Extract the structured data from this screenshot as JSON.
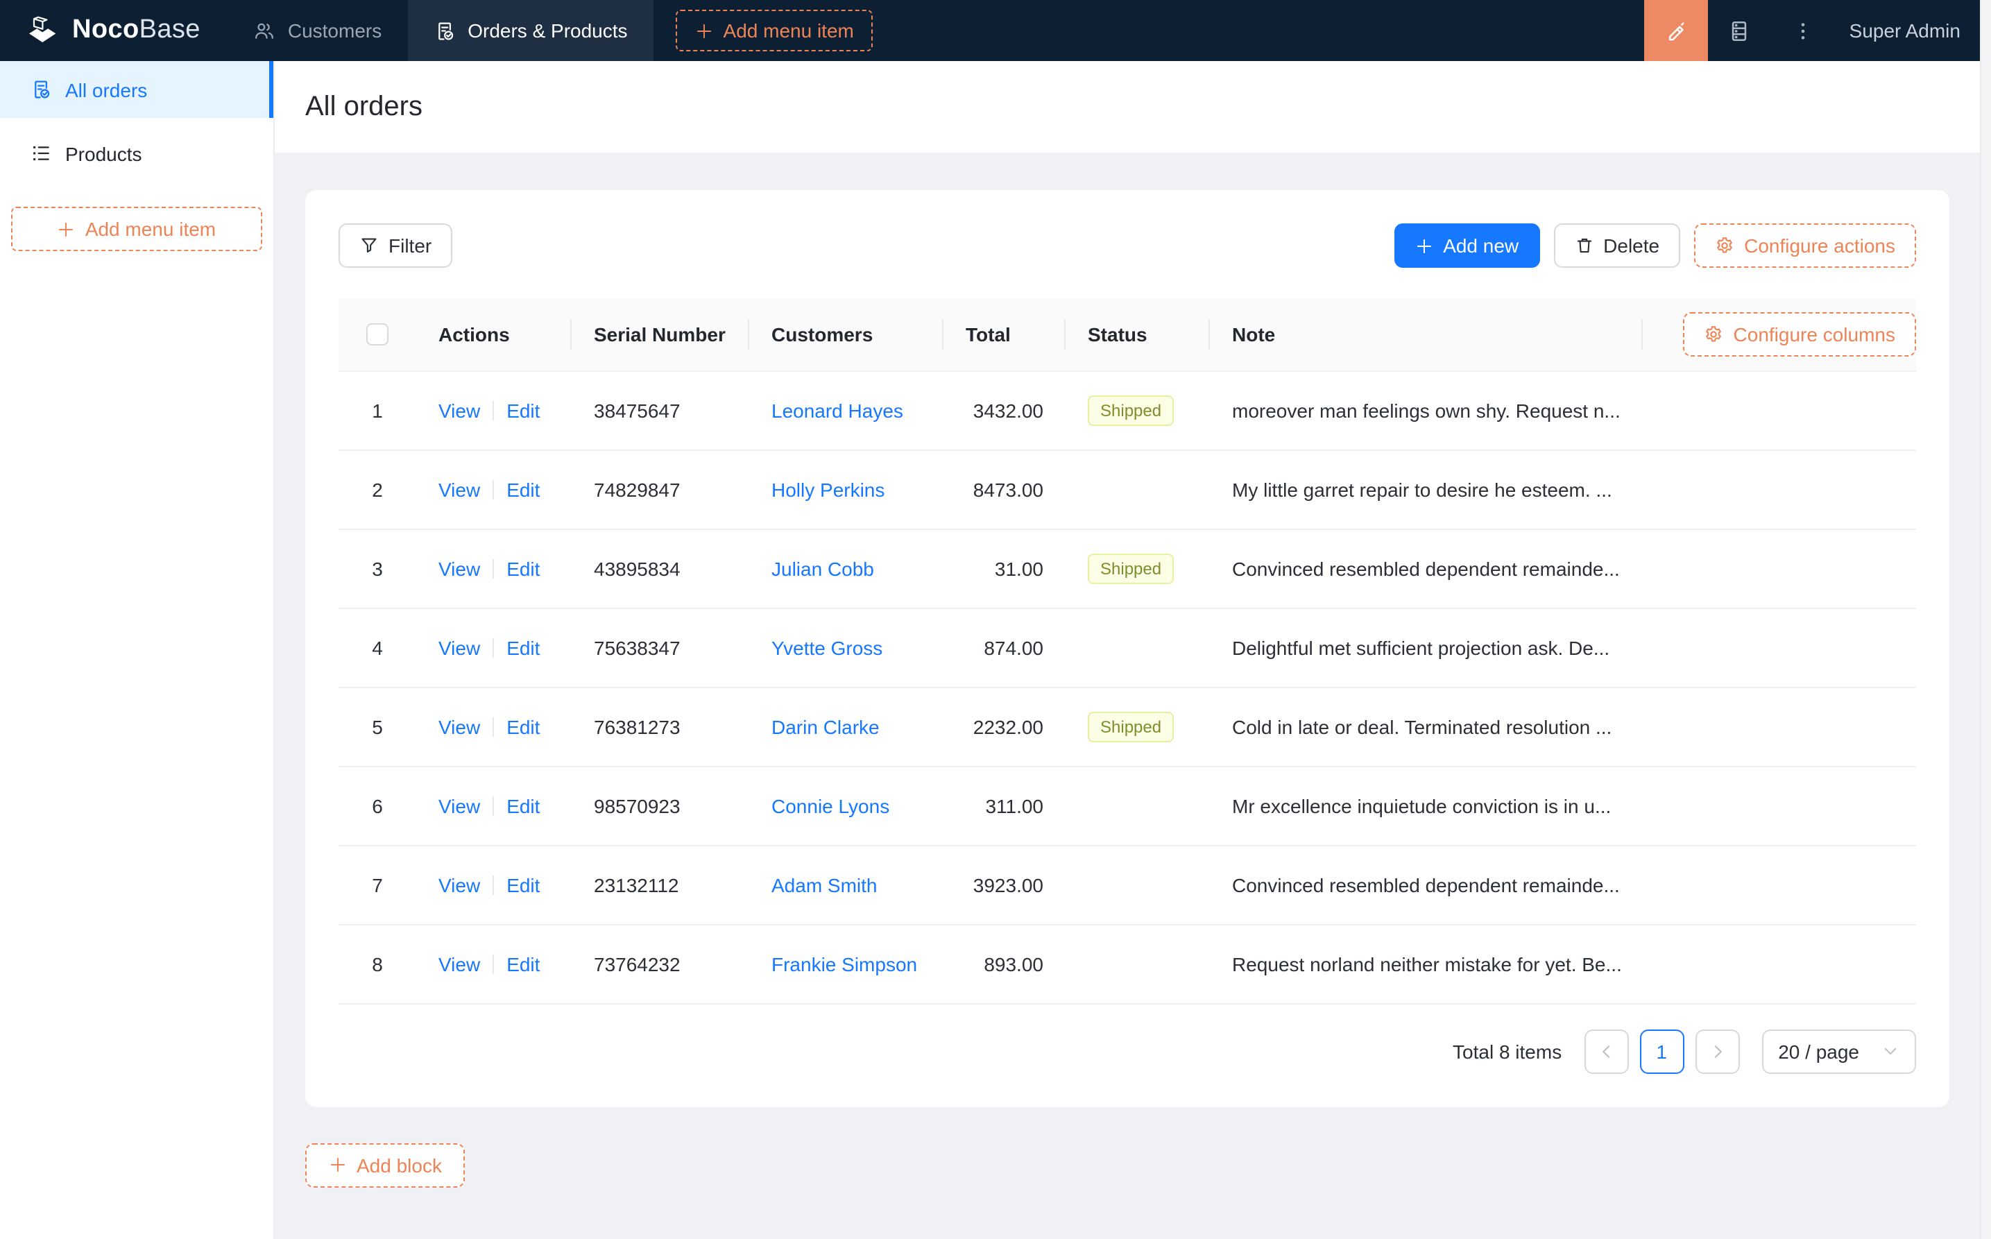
{
  "header": {
    "logo": {
      "bold": "Noco",
      "light": "Base"
    },
    "nav": [
      {
        "label": "Customers",
        "icon": "team-icon",
        "active": false
      },
      {
        "label": "Orders & Products",
        "icon": "file-done-icon",
        "active": true
      }
    ],
    "add_menu_item_label": "Add menu item",
    "user": "Super Admin"
  },
  "sidebar": {
    "items": [
      {
        "label": "All orders",
        "icon": "file-done-icon",
        "active": true
      },
      {
        "label": "Products",
        "icon": "list-icon",
        "active": false
      }
    ],
    "add_menu_item_label": "Add menu item"
  },
  "page": {
    "title": "All orders"
  },
  "toolbar": {
    "filter": "Filter",
    "add_new": "Add new",
    "delete": "Delete",
    "configure_actions": "Configure actions"
  },
  "table": {
    "configure_columns": "Configure columns",
    "columns": [
      "Actions",
      "Serial Number",
      "Customers",
      "Total",
      "Status",
      "Note"
    ],
    "action_labels": {
      "view": "View",
      "edit": "Edit"
    },
    "rows": [
      {
        "index": 1,
        "serial": "38475647",
        "customer": "Leonard Hayes",
        "total": "3432.00",
        "status": "Shipped",
        "note": "moreover man feelings own shy. Request n..."
      },
      {
        "index": 2,
        "serial": "74829847",
        "customer": "Holly Perkins",
        "total": "8473.00",
        "status": "",
        "note": "My little garret repair to desire he esteem. ..."
      },
      {
        "index": 3,
        "serial": "43895834",
        "customer": "Julian Cobb",
        "total": "31.00",
        "status": "Shipped",
        "note": "Convinced resembled dependent remainde..."
      },
      {
        "index": 4,
        "serial": "75638347",
        "customer": "Yvette Gross",
        "total": "874.00",
        "status": "",
        "note": "Delightful met sufficient projection ask. De..."
      },
      {
        "index": 5,
        "serial": "76381273",
        "customer": "Darin Clarke",
        "total": "2232.00",
        "status": "Shipped",
        "note": "Cold in late or deal. Terminated resolution ..."
      },
      {
        "index": 6,
        "serial": "98570923",
        "customer": "Connie Lyons",
        "total": "311.00",
        "status": "",
        "note": "Mr excellence inquietude conviction is in u..."
      },
      {
        "index": 7,
        "serial": "23132112",
        "customer": "Adam Smith",
        "total": "3923.00",
        "status": "",
        "note": "Convinced resembled dependent remainde..."
      },
      {
        "index": 8,
        "serial": "73764232",
        "customer": "Frankie Simpson",
        "total": "893.00",
        "status": "",
        "note": "Request norland neither mistake for yet. Be..."
      }
    ]
  },
  "pagination": {
    "total_text": "Total 8 items",
    "current_page": "1",
    "page_size": "20 / page"
  },
  "footer": {
    "add_block_label": "Add block"
  },
  "colors": {
    "header_bg": "#0d1f33",
    "accent": "#ee8456",
    "primary": "#1677ff",
    "status_tag_bg": "#fcffe6",
    "status_tag_border": "#e6f0a0",
    "status_tag_text": "#7d8f2a"
  }
}
